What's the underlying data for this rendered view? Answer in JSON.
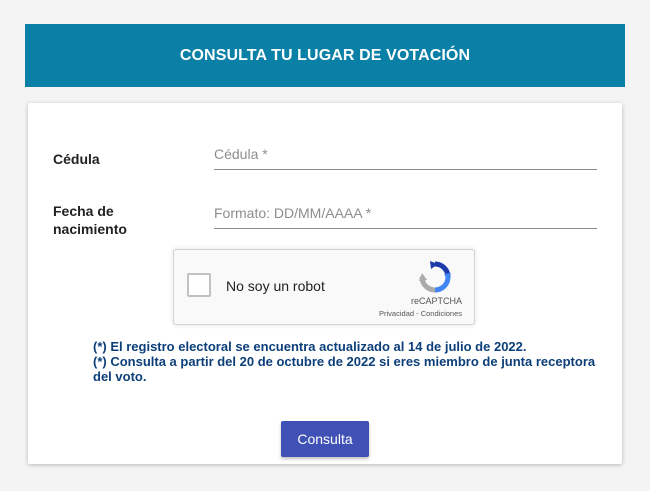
{
  "header": {
    "title": "CONSULTA TU LUGAR DE VOTACIÓN"
  },
  "form": {
    "cedula_label": "Cédula",
    "cedula_placeholder": "Cédula *",
    "cedula_value": "",
    "fecha_label_line1": "Fecha de",
    "fecha_label_line2": "nacimiento",
    "fecha_placeholder": "Formato: DD/MM/AAAA *",
    "fecha_value": ""
  },
  "captcha": {
    "label": "No soy un robot",
    "brand": "reCAPTCHA",
    "privacy": "Privacidad",
    "separator": " - ",
    "terms": "Condiciones"
  },
  "notes": [
    "(*) El registro electoral se encuentra actualizado al 14 de julio de 2022.",
    "(*) Consulta a partir del 20 de octubre de 2022 si eres miembro de junta receptora del voto."
  ],
  "submit_label": "Consulta",
  "colors": {
    "header_bg": "#0b80a6",
    "notes_text": "#0c3f79",
    "button_bg": "#3f51b5"
  }
}
